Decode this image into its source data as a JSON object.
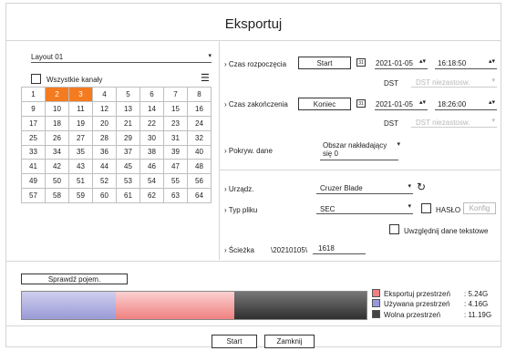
{
  "dialog": {
    "title": "Eksportuj"
  },
  "layout": {
    "selected": "Layout 01"
  },
  "channels": {
    "all_label": "Wszystkie kanały",
    "numbers": [
      1,
      2,
      3,
      4,
      5,
      6,
      7,
      8,
      9,
      10,
      11,
      12,
      13,
      14,
      15,
      16,
      17,
      18,
      19,
      20,
      21,
      22,
      23,
      24,
      25,
      26,
      27,
      28,
      29,
      30,
      31,
      32,
      33,
      34,
      35,
      36,
      37,
      38,
      39,
      40,
      41,
      42,
      43,
      44,
      45,
      46,
      47,
      48,
      49,
      50,
      51,
      52,
      53,
      54,
      55,
      56,
      57,
      58,
      59,
      60,
      61,
      62,
      63,
      64
    ],
    "selected": [
      2,
      3
    ]
  },
  "start": {
    "label": "Czas rozpoczęcia",
    "button": "Start",
    "date": "2021-01-05",
    "time": "16:18:50",
    "dst_label": "DST",
    "dst_value": "DST niezastosw."
  },
  "end": {
    "label": "Czas zakończenia",
    "button": "Koniec",
    "date": "2021-01-05",
    "time": "18:26:00",
    "dst_label": "DST",
    "dst_value": "DST niezastosw."
  },
  "overlap": {
    "label": "Pokryw. dane",
    "value_line1": "Obszar nakładający",
    "value_line2": "się 0"
  },
  "device": {
    "label": "Urządz.",
    "value": "Cruzer Blade"
  },
  "filetype": {
    "label": "Typ pliku",
    "value": "SEC",
    "password_label": "HASŁO",
    "config_button": "Konfig",
    "include_text_label": "Uwzględnij dane tekstowe"
  },
  "path": {
    "label": "Ścieżka",
    "prefix": "\\20210105\\",
    "value": "1618"
  },
  "capacity": {
    "check_button": "Sprawdź pojem.",
    "legend": [
      {
        "label": "Eksportuj przestrzeń",
        "value": ": 5.24G",
        "color": "#f08080"
      },
      {
        "label": "Używana przestrzeń",
        "value": ": 4.16G",
        "color": "#9999dd"
      },
      {
        "label": "Wolna przestrzeń",
        "value": ": 11.19G",
        "color": "#444444"
      }
    ]
  },
  "footer": {
    "start_button": "Start",
    "close_button": "Zamknij"
  },
  "icons": {
    "dropdown": "▾",
    "spin": "▴▾",
    "calendar": "31",
    "refresh": "↻",
    "list": "☰"
  }
}
